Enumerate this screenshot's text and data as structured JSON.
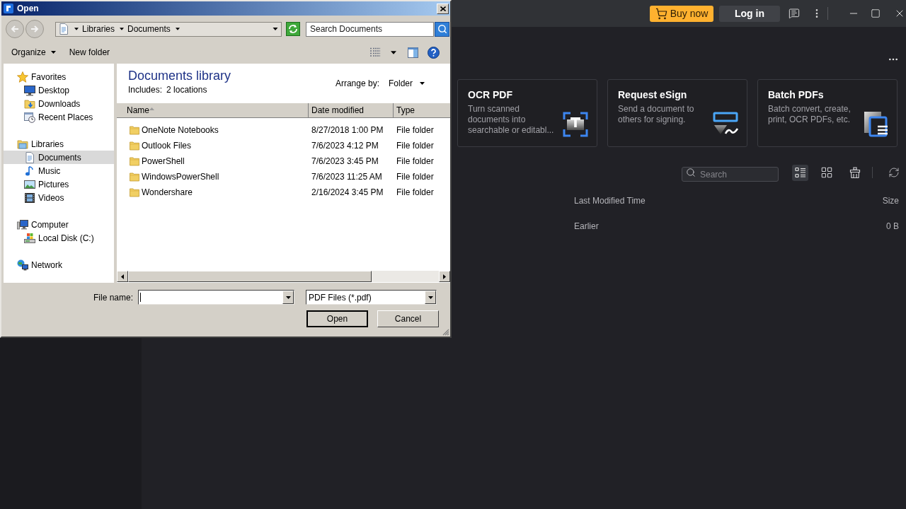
{
  "app": {
    "top_bar": {
      "buy_button": "Buy now",
      "login_button": "Log in"
    },
    "tool_cards": [
      {
        "kind": "ocr",
        "title": "OCR PDF",
        "description": "Turn scanned documents into searchable or editabl..."
      },
      {
        "kind": "esign",
        "title": "Request eSign",
        "description": "Send a document to others for signing."
      },
      {
        "kind": "batch",
        "title": "Batch PDFs",
        "description": "Batch convert, create, print, OCR PDFs, etc."
      }
    ],
    "file_toolbar": {
      "search": {
        "placeholder": "Search"
      },
      "views": [
        {
          "kind": "list",
          "selected": true
        },
        {
          "kind": "grid",
          "selected": false
        }
      ]
    },
    "file_table": {
      "columns": [
        "Last Modified Time",
        "Size"
      ],
      "rows": [
        {
          "last_modified_time": "Earlier",
          "size": "0 B"
        }
      ]
    }
  },
  "dialog": {
    "title": "Open",
    "breadcrumb": [
      "Libraries",
      "Documents"
    ],
    "search": {
      "placeholder": "Search Documents"
    },
    "toolbar": {
      "organize": "Organize",
      "new_folder": "New folder"
    },
    "nav": [
      {
        "label": "Favorites",
        "kind": "favorites",
        "selected": false,
        "children": [
          {
            "label": "Desktop",
            "kind": "desktop",
            "selected": false
          },
          {
            "label": "Downloads",
            "kind": "downloads",
            "selected": false
          },
          {
            "label": "Recent Places",
            "kind": "recent",
            "selected": false
          }
        ]
      },
      {
        "label": "Libraries",
        "kind": "libraries",
        "selected": false,
        "children": [
          {
            "label": "Documents",
            "kind": "documents",
            "selected": true
          },
          {
            "label": "Music",
            "kind": "music",
            "selected": false
          },
          {
            "label": "Pictures",
            "kind": "pictures",
            "selected": false
          },
          {
            "label": "Videos",
            "kind": "videos",
            "selected": false
          }
        ]
      },
      {
        "label": "Computer",
        "kind": "computer",
        "selected": false,
        "children": [
          {
            "label": "Local Disk (C:)",
            "kind": "disk",
            "selected": false
          }
        ]
      },
      {
        "label": "Network",
        "kind": "network",
        "selected": false
      }
    ],
    "library": {
      "title": "Documents library",
      "includes_label": "Includes:",
      "locations_link": "2 locations",
      "arrange_label": "Arrange by:",
      "arrange_value": "Folder"
    },
    "columns": [
      {
        "label": "Name",
        "sorted": true
      },
      {
        "label": "Date modified",
        "sorted": false
      },
      {
        "label": "Type",
        "sorted": false
      }
    ],
    "rows": [
      {
        "name": "OneNote Notebooks",
        "date_modified": "8/27/2018 1:00 PM",
        "type": "File folder"
      },
      {
        "name": "Outlook Files",
        "date_modified": "7/6/2023 4:12 PM",
        "type": "File folder"
      },
      {
        "name": "PowerShell",
        "date_modified": "7/6/2023 3:45 PM",
        "type": "File folder"
      },
      {
        "name": "WindowsPowerShell",
        "date_modified": "7/6/2023 11:25 AM",
        "type": "File folder"
      },
      {
        "name": "Wondershare",
        "date_modified": "2/16/2024 3:45 PM",
        "type": "File folder"
      }
    ],
    "file_name_label": "File name:",
    "file_type": "PDF Files (*.pdf)",
    "buttons": [
      {
        "label": "Open",
        "default": true
      },
      {
        "label": "Cancel",
        "default": false
      }
    ]
  }
}
